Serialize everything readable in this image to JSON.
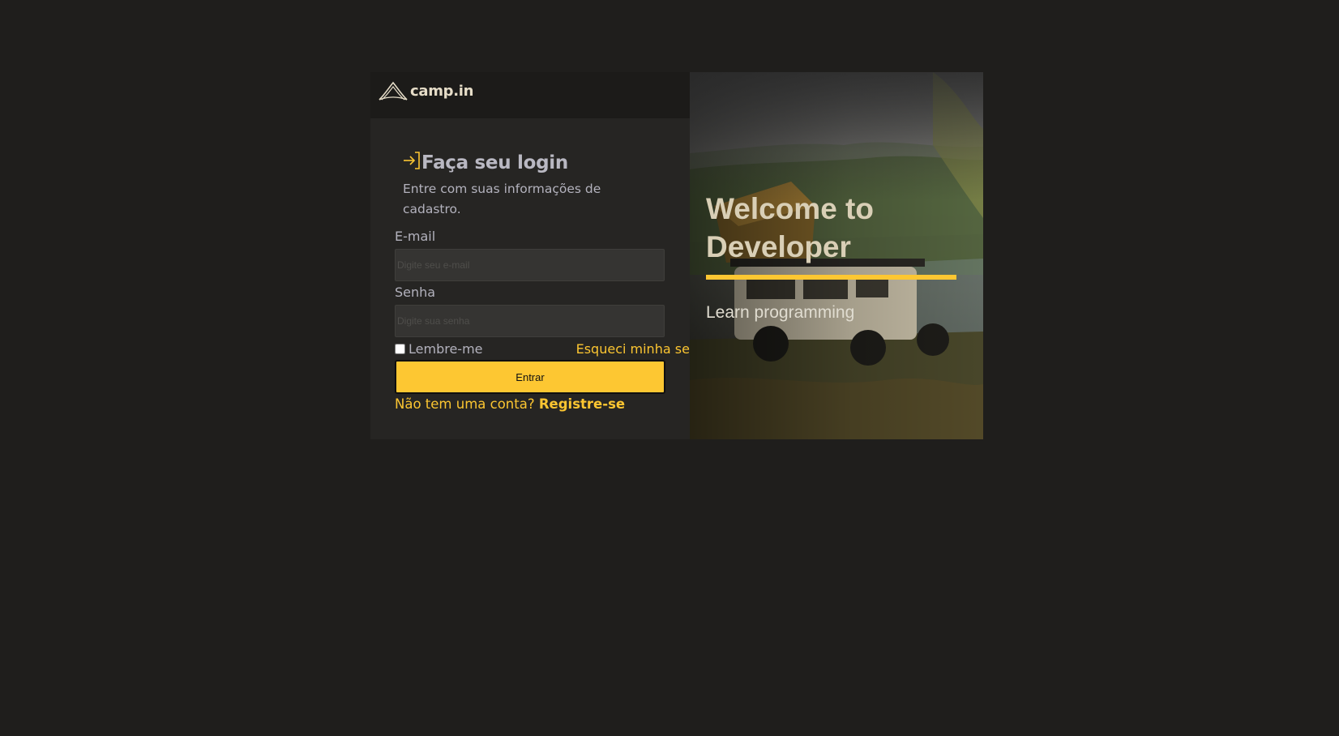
{
  "brand": {
    "name": "camp.in"
  },
  "login": {
    "title": "Faça seu login",
    "subtitle": "Entre com suas informações de cadastro.",
    "email_label": "E-mail",
    "email_placeholder": "Digite seu e-mail",
    "email_value": "",
    "password_label": "Senha",
    "password_placeholder": "Digite sua senha",
    "password_value": "",
    "remember_label": "Lembre-me",
    "remember_checked": false,
    "forgot_label": "Esqueci minha senha",
    "submit_label": "Entrar",
    "register_prompt": "Não tem uma conta?",
    "register_link": "Registre-se"
  },
  "hero": {
    "title": "Welcome to Developer",
    "subtitle": "Learn programming"
  },
  "icons": {
    "logo": "tent-icon",
    "login": "sign-in-arrow-icon"
  },
  "colors": {
    "page_background": "#1f1e1c",
    "panel_background": "#262523",
    "accent": "#fdc732",
    "text_muted": "#b3b2bd",
    "hero_title": "#d9cfb6"
  }
}
